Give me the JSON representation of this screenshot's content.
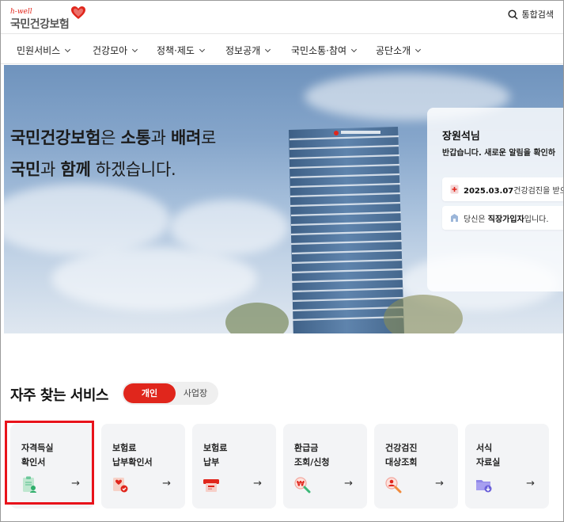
{
  "header": {
    "logo_sub": "h-well",
    "logo_main": "국민건강보험",
    "search_label": "통합검색",
    "search_icon": "search-icon"
  },
  "nav": {
    "items": [
      {
        "label": "민원서비스"
      },
      {
        "label": "건강모아"
      },
      {
        "label": "정책·제도"
      },
      {
        "label": "정보공개"
      },
      {
        "label": "국민소통·참여"
      },
      {
        "label": "공단소개"
      }
    ]
  },
  "hero": {
    "line1_a": "국민건강보험",
    "line1_b": "은 ",
    "line1_c": "소통",
    "line1_d": "과 ",
    "line1_e": "배려",
    "line1_f": "로",
    "line2_a": "국민",
    "line2_b": "과 ",
    "line2_c": "함께",
    "line2_d": " 하겠습니다."
  },
  "user_panel": {
    "name": "장원석님",
    "greeting": "반갑습니다. 새로운 알림을 확인하",
    "notice1_date": "2025.03.07",
    "notice1_text": "건강검진을 받으",
    "notice2_prefix": "당신은 ",
    "notice2_bold": "직장가입자",
    "notice2_suffix": "입니다."
  },
  "services": {
    "title": "자주 찾는 서비스",
    "toggle_on": "개인",
    "toggle_off": "사업장",
    "cards": [
      {
        "label": "자격득실\n확인서",
        "icon": "certificate-icon",
        "arrow": "→"
      },
      {
        "label": "보험료\n납부확인서",
        "icon": "payment-certificate-icon",
        "arrow": "→"
      },
      {
        "label": "보험료\n납부",
        "icon": "payment-icon",
        "arrow": "→"
      },
      {
        "label": "환급금\n조회/신청",
        "icon": "refund-search-icon",
        "arrow": "→"
      },
      {
        "label": "건강검진\n대상조회",
        "icon": "checkup-search-icon",
        "arrow": "→"
      },
      {
        "label": "서식\n자료실",
        "icon": "forms-folder-icon",
        "arrow": "→"
      }
    ]
  },
  "colors": {
    "brand_red": "#e0261c",
    "highlight_red": "#e8131b"
  }
}
